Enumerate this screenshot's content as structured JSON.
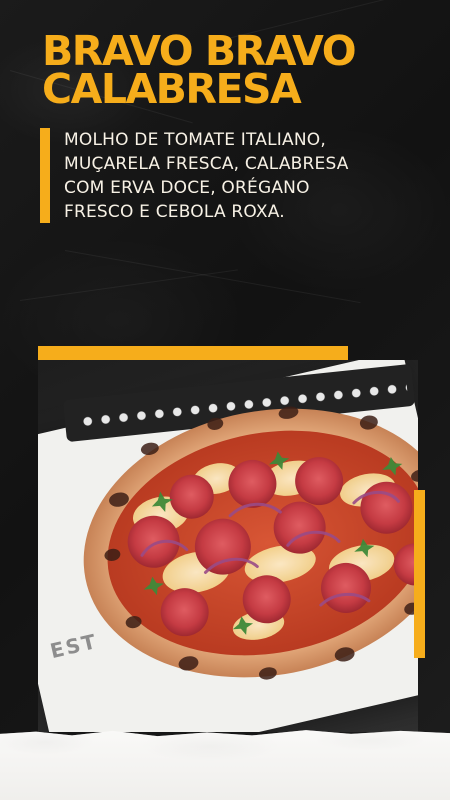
{
  "headline": {
    "line1": "BRAVO BRAVO",
    "line2": "CALABRESA"
  },
  "description": {
    "line1": "MOLHO DE TOMATE ITALIANO,",
    "line2": "MUÇARELA FRESCA, CALABRESA",
    "line3": "COM ERVA DOCE, ORÉGANO",
    "line4": "FRESCO E CEBOLA ROXA."
  },
  "photo": {
    "paper_text": "EST"
  },
  "colors": {
    "accent": "#f6ad1b",
    "background": "#181818",
    "text": "#f7f1e5"
  }
}
